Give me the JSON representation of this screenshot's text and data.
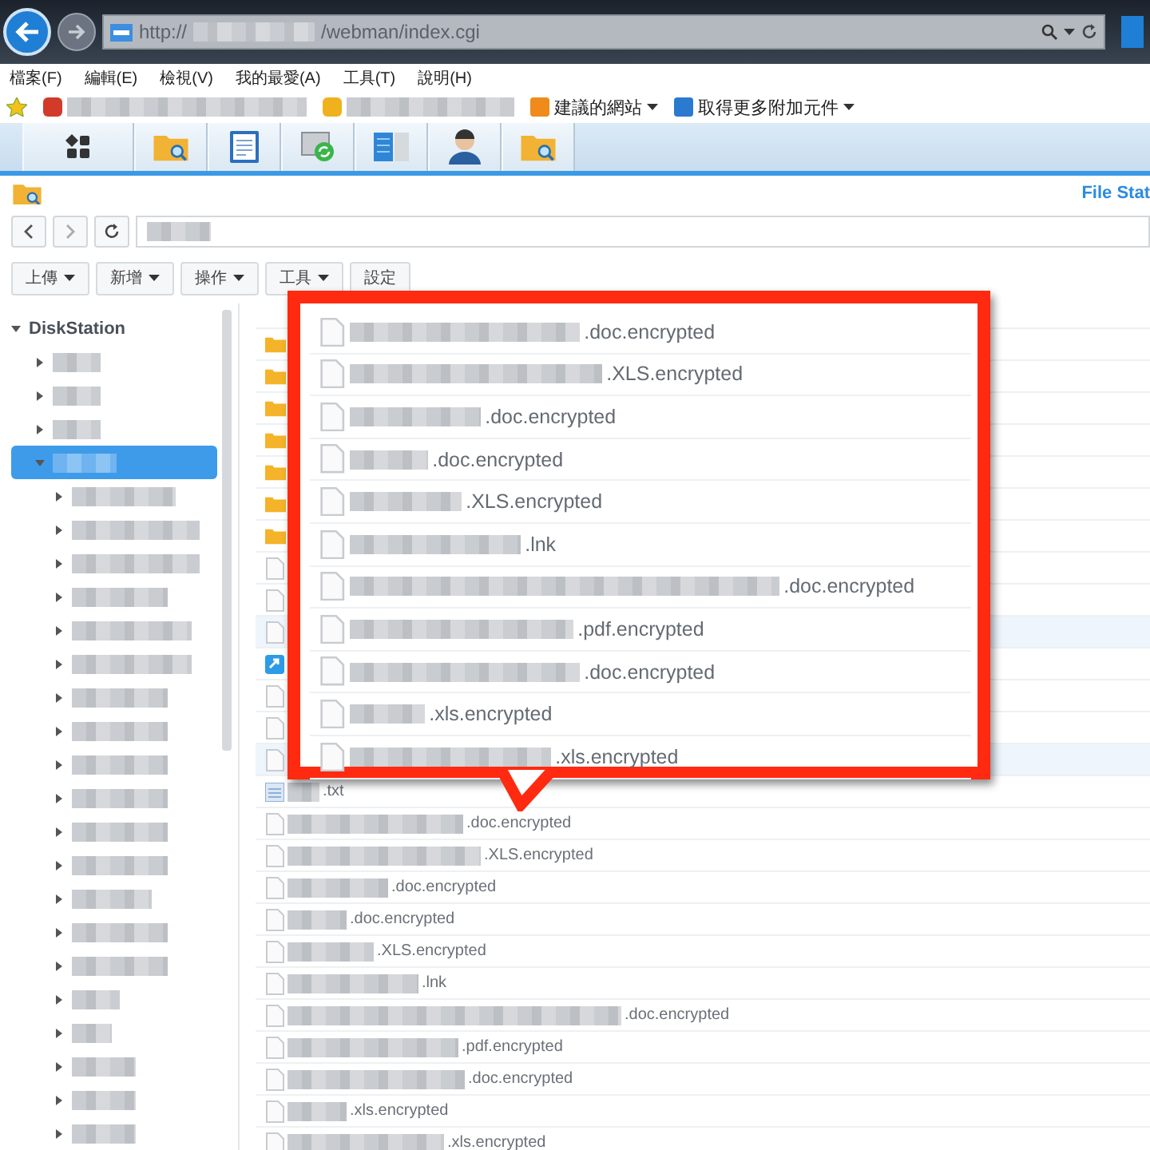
{
  "browser": {
    "address_prefix": "http://",
    "address_suffix": "/webman/index.cgi"
  },
  "menu": [
    "檔案(F)",
    "編輯(E)",
    "檢視(V)",
    "我的最愛(A)",
    "工具(T)",
    "說明(H)"
  ],
  "favorites": [
    {
      "kind": "blurred"
    },
    {
      "kind": "blurred"
    },
    {
      "kind": "link",
      "label": "建議的網站"
    },
    {
      "kind": "link",
      "label": "取得更多附加元件"
    }
  ],
  "app": {
    "title": "File Stat"
  },
  "toolbar": [
    {
      "label": "上傳",
      "dropdown": true
    },
    {
      "label": "新增",
      "dropdown": true
    },
    {
      "label": "操作",
      "dropdown": true
    },
    {
      "label": "工具",
      "dropdown": true
    },
    {
      "label": "設定",
      "dropdown": false
    }
  ],
  "tree": {
    "label": "DiskStation",
    "expanded": true,
    "children": [
      {
        "selected": false,
        "expanded": false
      },
      {
        "selected": false,
        "expanded": false
      },
      {
        "selected": false,
        "expanded": false
      },
      {
        "selected": true,
        "expanded": true,
        "children": [
          {
            "expanded": false
          },
          {
            "expanded": false
          },
          {
            "expanded": false
          },
          {
            "expanded": false
          },
          {
            "expanded": false
          },
          {
            "expanded": false
          },
          {
            "expanded": false
          },
          {
            "expanded": false
          },
          {
            "expanded": false
          },
          {
            "expanded": false
          },
          {
            "expanded": false
          },
          {
            "expanded": false
          },
          {
            "expanded": false
          },
          {
            "expanded": false
          },
          {
            "expanded": false
          },
          {
            "expanded": false
          },
          {
            "expanded": false
          },
          {
            "expanded": false
          },
          {
            "expanded": false
          },
          {
            "expanded": false
          }
        ]
      }
    ]
  },
  "files": [
    {
      "kind": "folder",
      "selected": false
    },
    {
      "kind": "folder",
      "selected": false
    },
    {
      "kind": "folder",
      "selected": false
    },
    {
      "kind": "folder",
      "selected": false
    },
    {
      "kind": "folder",
      "selected": false
    },
    {
      "kind": "folder",
      "selected": false
    },
    {
      "kind": "folder",
      "selected": false
    },
    {
      "kind": "file",
      "selected": false
    },
    {
      "kind": "file",
      "selected": false
    },
    {
      "kind": "file",
      "selected": true
    },
    {
      "kind": "shortcut",
      "selected": false
    },
    {
      "kind": "file",
      "selected": false
    },
    {
      "kind": "file",
      "selected": false
    },
    {
      "kind": "file",
      "selected": true
    },
    {
      "kind": "text",
      "selected": false,
      "suffix": ".txt"
    },
    {
      "kind": "file",
      "selected": false,
      "suffix": ".doc.encrypted"
    },
    {
      "kind": "file",
      "selected": false,
      "suffix": ".XLS.encrypted"
    },
    {
      "kind": "file",
      "selected": false,
      "suffix": ".doc.encrypted"
    },
    {
      "kind": "file",
      "selected": false,
      "suffix": ".doc.encrypted"
    },
    {
      "kind": "file",
      "selected": false,
      "suffix": ".XLS.encrypted"
    },
    {
      "kind": "file",
      "selected": false,
      "suffix": ".lnk"
    },
    {
      "kind": "file",
      "selected": false,
      "suffix": ".doc.encrypted"
    },
    {
      "kind": "file",
      "selected": false,
      "suffix": ".pdf.encrypted"
    },
    {
      "kind": "file",
      "selected": false,
      "suffix": ".doc.encrypted"
    },
    {
      "kind": "file",
      "selected": false,
      "suffix": ".xls.encrypted"
    },
    {
      "kind": "file",
      "selected": false,
      "suffix": ".xls.encrypted"
    }
  ],
  "callout": {
    "files": [
      ".doc.encrypted",
      ".XLS.encrypted",
      ".doc.encrypted",
      ".doc.encrypted",
      ".XLS.encrypted",
      ".lnk",
      ".doc.encrypted",
      ".pdf.encrypted",
      ".doc.encrypted",
      ".xls.encrypted",
      ".xls.encrypted"
    ]
  }
}
